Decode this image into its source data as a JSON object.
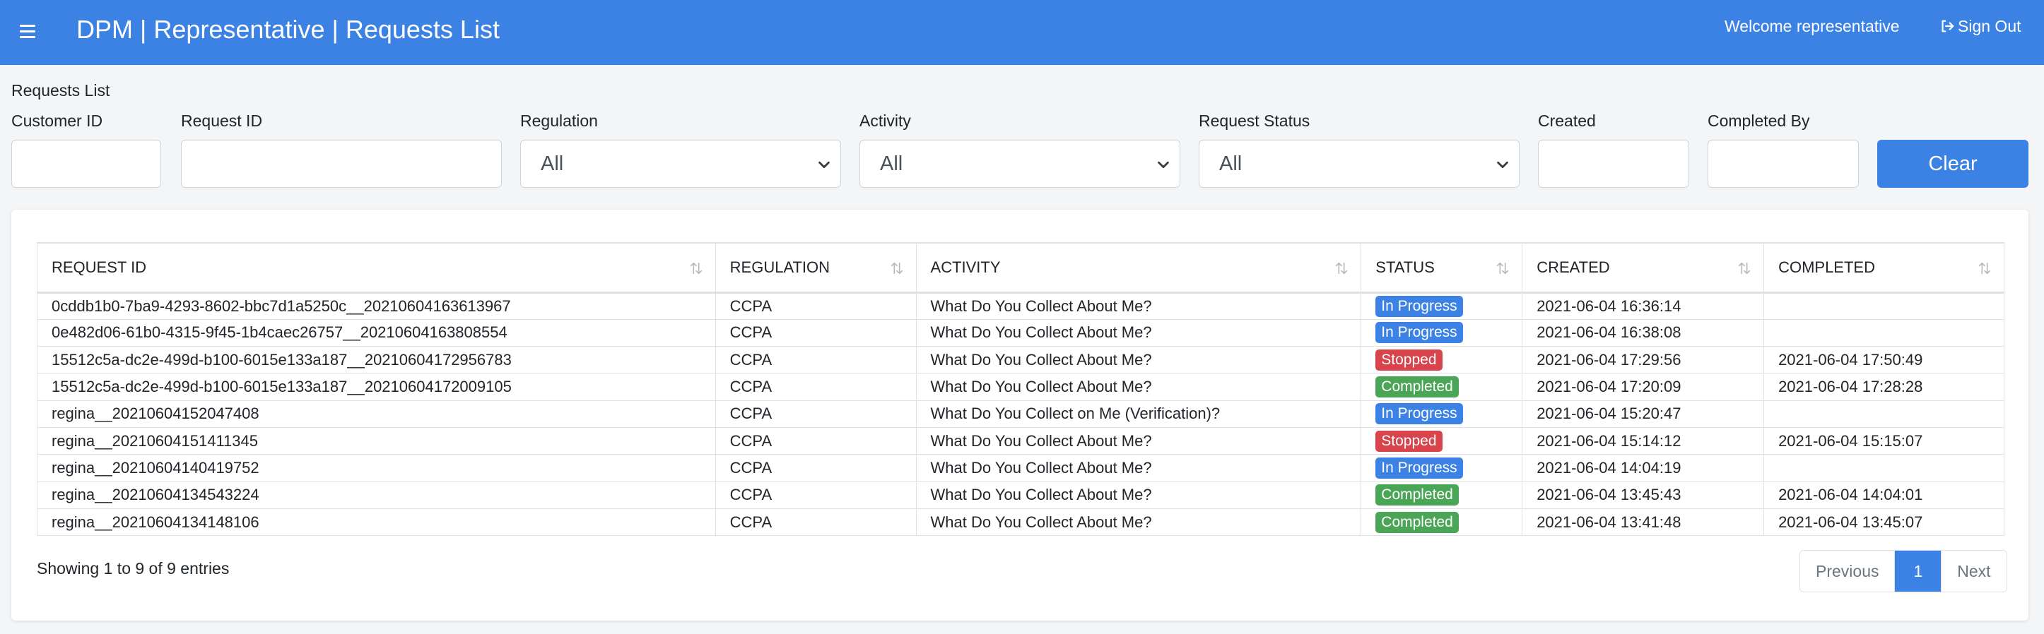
{
  "header": {
    "title": "DPM | Representative | Requests List",
    "welcome": "Welcome representative",
    "signout_label": "Sign Out",
    "bg_color": "#3b82e4"
  },
  "section_label": "Requests List",
  "filters": {
    "customer_id_label": "Customer ID",
    "customer_id_value": "",
    "request_id_label": "Request ID",
    "request_id_value": "",
    "regulation_label": "Regulation",
    "regulation_value": "All",
    "activity_label": "Activity",
    "activity_value": "All",
    "status_label": "Request Status",
    "status_value": "All",
    "created_label": "Created",
    "created_value": "",
    "completed_by_label": "Completed By",
    "completed_by_value": "",
    "clear_label": "Clear"
  },
  "table": {
    "columns": [
      "REQUEST ID",
      "REGULATION",
      "ACTIVITY",
      "STATUS",
      "CREATED",
      "COMPLETED"
    ],
    "rows": [
      {
        "request_id": "0cddb1b0-7ba9-4293-8602-bbc7d1a5250c__20210604163613967",
        "regulation": "CCPA",
        "activity": "What Do You Collect About Me?",
        "status": "In Progress",
        "created": "2021-06-04 16:36:14",
        "completed": ""
      },
      {
        "request_id": "0e482d06-61b0-4315-9f45-1b4caec26757__20210604163808554",
        "regulation": "CCPA",
        "activity": "What Do You Collect About Me?",
        "status": "In Progress",
        "created": "2021-06-04 16:38:08",
        "completed": ""
      },
      {
        "request_id": "15512c5a-dc2e-499d-b100-6015e133a187__20210604172956783",
        "regulation": "CCPA",
        "activity": "What Do You Collect About Me?",
        "status": "Stopped",
        "created": "2021-06-04 17:29:56",
        "completed": "2021-06-04 17:50:49"
      },
      {
        "request_id": "15512c5a-dc2e-499d-b100-6015e133a187__20210604172009105",
        "regulation": "CCPA",
        "activity": "What Do You Collect About Me?",
        "status": "Completed",
        "created": "2021-06-04 17:20:09",
        "completed": "2021-06-04 17:28:28"
      },
      {
        "request_id": "regina__20210604152047408",
        "regulation": "CCPA",
        "activity": "What Do You Collect on Me (Verification)?",
        "status": "In Progress",
        "created": "2021-06-04 15:20:47",
        "completed": ""
      },
      {
        "request_id": "regina__20210604151411345",
        "regulation": "CCPA",
        "activity": "What Do You Collect About Me?",
        "status": "Stopped",
        "created": "2021-06-04 15:14:12",
        "completed": "2021-06-04 15:15:07"
      },
      {
        "request_id": "regina__20210604140419752",
        "regulation": "CCPA",
        "activity": "What Do You Collect About Me?",
        "status": "In Progress",
        "created": "2021-06-04 14:04:19",
        "completed": ""
      },
      {
        "request_id": "regina__20210604134543224",
        "regulation": "CCPA",
        "activity": "What Do You Collect About Me?",
        "status": "Completed",
        "created": "2021-06-04 13:45:43",
        "completed": "2021-06-04 14:04:01"
      },
      {
        "request_id": "regina__20210604134148106",
        "regulation": "CCPA",
        "activity": "What Do You Collect About Me?",
        "status": "Completed",
        "created": "2021-06-04 13:41:48",
        "completed": "2021-06-04 13:45:07"
      }
    ],
    "status_colors": {
      "In Progress": "#3b82e4",
      "Stopped": "#d9434b",
      "Completed": "#4ba557"
    }
  },
  "footer": {
    "showing": "Showing 1 to 9 of 9 entries",
    "previous_label": "Previous",
    "current_page": "1",
    "next_label": "Next"
  }
}
